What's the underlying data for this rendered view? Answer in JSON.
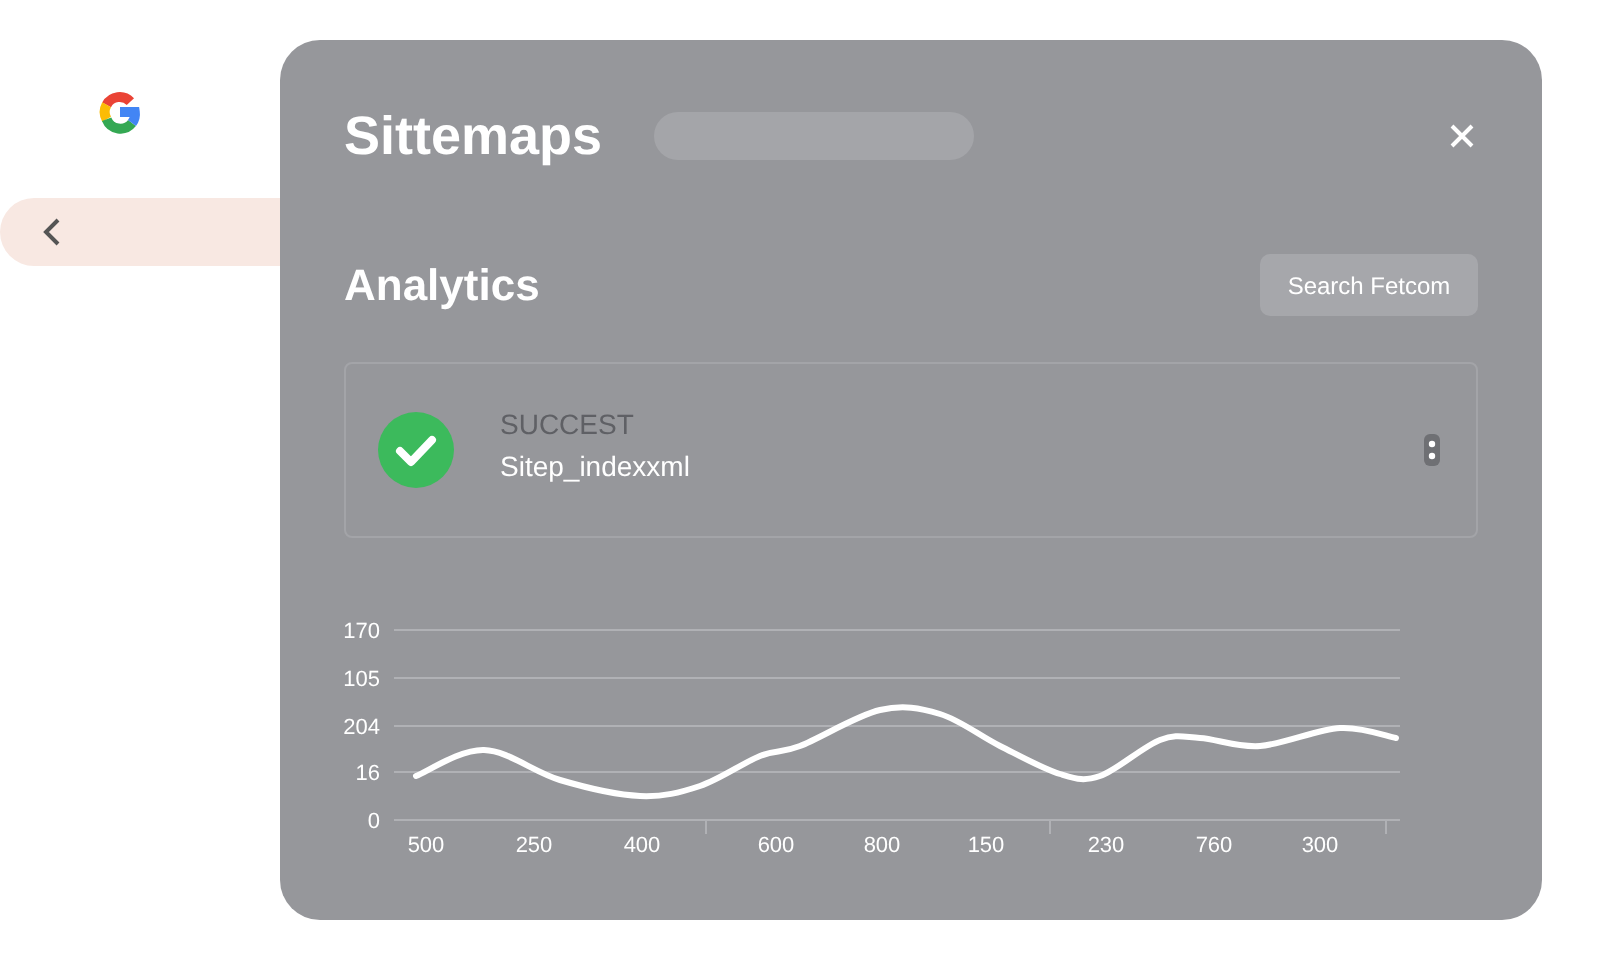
{
  "dialog": {
    "title": "Sittemaps",
    "heading": "Analytics",
    "action_button": "Search Fetcom",
    "sitemap": {
      "kind": "success",
      "status": "SUCCEST",
      "name": "Sitep_indexxml"
    },
    "chart": {
      "y_labels": [
        "170",
        "105",
        "204",
        "16",
        "0"
      ],
      "x_labels": [
        "500",
        "250",
        "400",
        "600",
        "800",
        "150",
        "230",
        "760",
        "300"
      ]
    }
  }
}
